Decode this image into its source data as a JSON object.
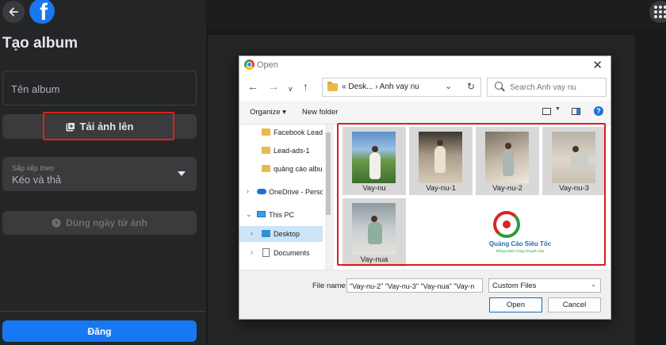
{
  "panel": {
    "title": "Tạo album",
    "album_name_placeholder": "Tên album",
    "upload_button": "Tải ảnh lên",
    "sort": {
      "label": "Sắp xếp theo",
      "value": "Kéo và thả"
    },
    "date_button": "Dùng ngày từ ảnh",
    "post_button": "Đăng",
    "colors": {
      "primary": "#1877f2",
      "highlight": "#e0201e"
    }
  },
  "dialog": {
    "title": "Open",
    "path": "« Desk... › Anh vay nu",
    "search_placeholder": "Search Anh vay nu",
    "toolbar": {
      "organize": "Organize ▾",
      "new_folder": "New folder",
      "help": "?"
    },
    "nav_items": [
      {
        "label": "Facebook Lead",
        "icon": "folder-icon"
      },
      {
        "label": "Lead-ads-1",
        "icon": "folder-icon"
      },
      {
        "label": "quảng cáo albu",
        "icon": "folder-icon"
      },
      {
        "label": "OneDrive - Perso",
        "icon": "onedrive-icon"
      },
      {
        "label": "This PC",
        "icon": "pc-icon"
      },
      {
        "label": "Desktop",
        "icon": "desktop-icon",
        "selected": true
      },
      {
        "label": "Documents",
        "icon": "documents-icon"
      }
    ],
    "files": [
      {
        "name": "Vay-nu"
      },
      {
        "name": "Vay-nu-1"
      },
      {
        "name": "Vay-nu-2"
      },
      {
        "name": "Vay-nu-3"
      },
      {
        "name": "Vay-nua"
      }
    ],
    "watermark": {
      "title": "Quảng Cáo Siêu Tốc",
      "subtitle": "Đồng Hành Cùng Chuyên Gia"
    },
    "file_name_label": "File name:",
    "file_name_value": "\"Vay-nu-2\" \"Vay-nu-3\" \"Vay-nua\" \"Vay-n",
    "file_type": "Custom Files",
    "open_button": "Open",
    "cancel_button": "Cancel"
  }
}
